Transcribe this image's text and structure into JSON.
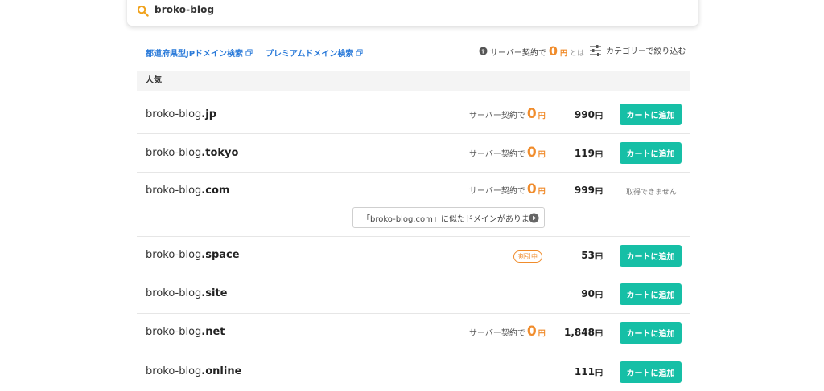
{
  "search": {
    "query": "broko-blog"
  },
  "links": [
    {
      "label": "都道府県型JPドメイン検索"
    },
    {
      "label": "プレミアムドメイン検索"
    }
  ],
  "promo": {
    "prefix": "サーバー契約で",
    "zero": "0",
    "yen": "円",
    "suffix": "とは"
  },
  "filter": {
    "label": "カテゴリーで絞り込む"
  },
  "section": {
    "title": "人気"
  },
  "common": {
    "server_text": "サーバー契約で",
    "zero": "0",
    "yen": "円",
    "cart_label": "カートに追加",
    "unavailable_label": "取得できません",
    "discount_label": "割引中"
  },
  "rows": [
    {
      "name": "broko-blog",
      "tld": ".jp",
      "price": "990",
      "server_zero": true,
      "action": "cart"
    },
    {
      "name": "broko-blog",
      "tld": ".tokyo",
      "price": "119",
      "server_zero": true,
      "action": "cart"
    },
    {
      "name": "broko-blog",
      "tld": ".com",
      "price": "999",
      "server_zero": true,
      "action": "unavailable",
      "similar": "「broko-blog.com」に似たドメインがあります"
    },
    {
      "name": "broko-blog",
      "tld": ".space",
      "price": "53",
      "server_zero": false,
      "discount": true,
      "action": "cart"
    },
    {
      "name": "broko-blog",
      "tld": ".site",
      "price": "90",
      "server_zero": false,
      "action": "cart"
    },
    {
      "name": "broko-blog",
      "tld": ".net",
      "price": "1,848",
      "server_zero": true,
      "action": "cart"
    },
    {
      "name": "broko-blog",
      "tld": ".online",
      "price": "111",
      "server_zero": false,
      "action": "cart"
    }
  ],
  "colors": {
    "accent": "#16bfa6",
    "orange": "#f08c2c",
    "link": "#2a7ad9"
  }
}
